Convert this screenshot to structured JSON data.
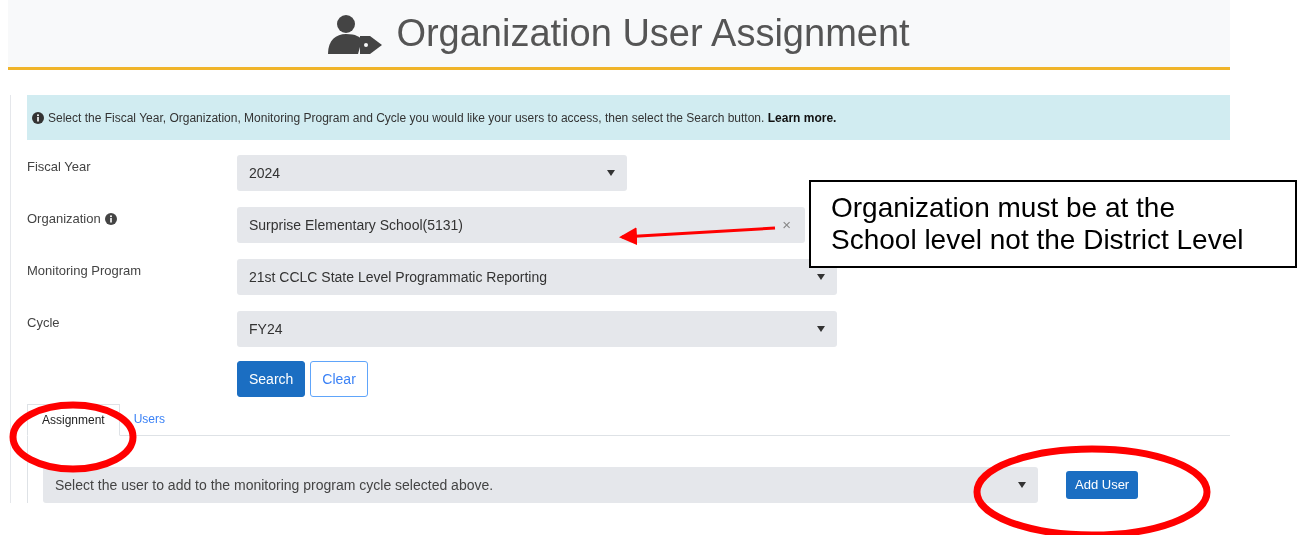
{
  "header": {
    "title": "Organization User Assignment"
  },
  "info": {
    "text": "Select the Fiscal Year, Organization, Monitoring Program and Cycle you would like your users to access, then select the Search button.",
    "link": "Learn more."
  },
  "fields": [
    {
      "label": "Fiscal Year",
      "value": "2024",
      "kind": "dropdown",
      "info": false
    },
    {
      "label": "Organization",
      "value": "Surprise Elementary School(5131)",
      "kind": "clearable",
      "info": true,
      "clear": "×"
    },
    {
      "label": "Monitoring Program",
      "value": "21st CCLC State Level Programmatic Reporting",
      "kind": "dropdown",
      "info": false
    },
    {
      "label": "Cycle",
      "value": "FY24",
      "kind": "dropdown",
      "info": false
    }
  ],
  "buttons": [
    {
      "label": "Search",
      "kind": "primary"
    },
    {
      "label": "Clear",
      "kind": "outline"
    }
  ],
  "tabs": [
    {
      "label": "Assignment",
      "selected": true
    },
    {
      "label": "Users",
      "selected": false
    }
  ],
  "user_select": {
    "placeholder": "Select the user to add to the monitoring program cycle selected above.",
    "button": "Add User"
  },
  "callout": {
    "text": "Organization must be at the School level not the District Level"
  }
}
